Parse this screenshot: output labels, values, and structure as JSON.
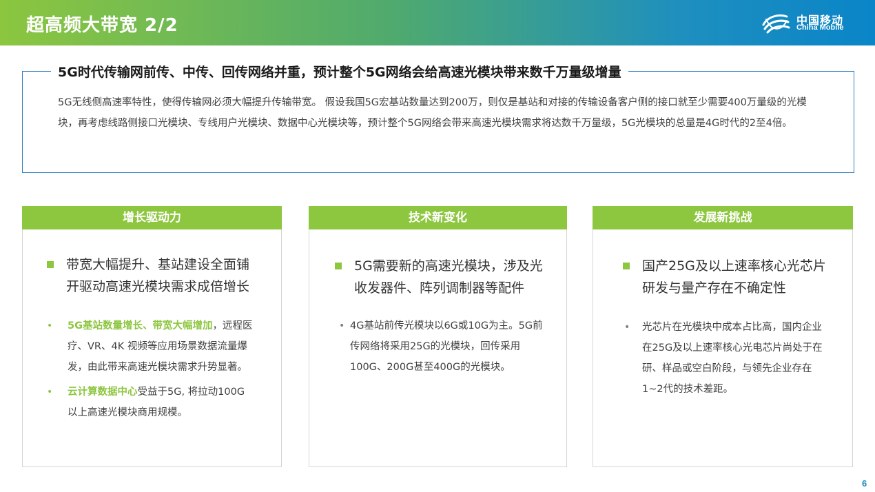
{
  "header": {
    "title": "超高频大带宽 2/2",
    "logo_cn": "中国移动",
    "logo_en": "China Mobile"
  },
  "summary": {
    "heading": "5G时代传输网前传、中传、回传网络并重，预计整个5G网络会给高速光模块带来数千万量级增量",
    "text": "5G无线侧高速率特性，使得传输网必须大幅提升传输带宽。 假设我国5G宏基站数量达到200万，则仅是基站和对接的传输设备客户侧的接口就至少需要400万量级的光模块，再考虑线路侧接口光模块、专线用户光模块、数据中心光模块等，预计整个5G网络会带来高速光模块需求将达数千万量级，5G光模块的总量是4G时代的2至4倍。"
  },
  "cards": [
    {
      "title": "增长驱动力",
      "main_line1": "带宽大幅提升、基站建设全面铺",
      "main_line2": "开驱动高速光模块需求成倍增长",
      "sub1_highlight": "5G基站数量增长、带宽大幅增加",
      "sub1_text": "，远程医疗、VR、4K 视频等应用场景数据流量爆发，由此带来高速光模块需求升势显著。",
      "sub2_highlight": "云计算数据中心",
      "sub2_text": "受益于5G, 将拉动100G以上高速光模块商用规模。"
    },
    {
      "title": "技术新变化",
      "main_line1": "5G需要新的高速光模块，涉及光",
      "main_line2": "收发器件、阵列调制器等配件",
      "sub1_text": "4G基站前传光模块以6G或10G为主。5G前传网络将采用25G的光模块，回传采用100G、200G甚至400G的光模块。"
    },
    {
      "title": "发展新挑战",
      "main_line1": "国产25G及以上速率核心光芯片",
      "main_line2": "研发与量产存在不确定性",
      "sub1_text": "光芯片在光模块中成本占比高，国内企业在25G及以上速率核心光电芯片尚处于在研、样品或空白阶段，与领先企业存在1~2代的技术差距。"
    }
  ],
  "page_number": "6",
  "colors": {
    "accent_green": "#8dc63f",
    "accent_blue": "#2d7fc1"
  }
}
